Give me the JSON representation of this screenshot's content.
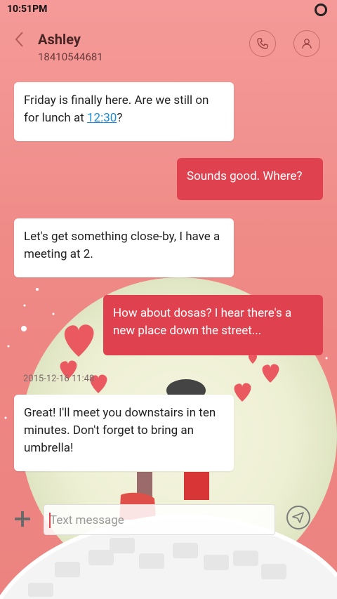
{
  "status_bar": {
    "time": "10:51PM"
  },
  "header": {
    "contact_name": "Ashley",
    "contact_number": "18410544681"
  },
  "messages": [
    {
      "direction": "incoming",
      "text_before": "Friday is finally here. Are we still on for lunch at ",
      "link": "12:30",
      "text_after": "?"
    },
    {
      "direction": "outgoing",
      "text": "Sounds good. Where?"
    },
    {
      "direction": "incoming",
      "text": "Let's get something close-by, I have a meeting at 2."
    },
    {
      "direction": "outgoing",
      "text": "How about dosas? I hear there's a new place down the street..."
    },
    {
      "direction": "incoming",
      "text": "Great! I'll meet you downstairs in ten minutes. Don't forget to bring an umbrella!"
    }
  ],
  "timestamp": "2015-12-16 11:48",
  "composer": {
    "placeholder": "Text message"
  },
  "colors": {
    "accent": "#e0414e",
    "background": "#f29391",
    "link": "#1a8cd8"
  }
}
